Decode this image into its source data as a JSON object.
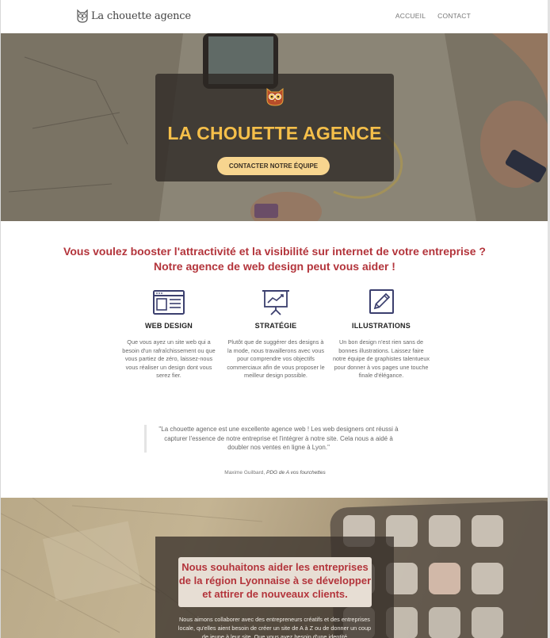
{
  "header": {
    "logo_text": "La chouette agence",
    "nav": [
      "ACCUEIL",
      "CONTACT"
    ]
  },
  "hero": {
    "title": "LA CHOUETTE AGENCE",
    "cta_label": "CONTACTER NOTRE ÉQUIPE"
  },
  "intro": {
    "line1": "Vous voulez booster l'attractivité et la visibilité sur internet de votre entreprise ?",
    "line2": "Notre agence de web design peut vous aider !"
  },
  "services": [
    {
      "icon": "browser-window-icon",
      "title": "WEB DESIGN",
      "text": "Que vous ayez un site web qui a besoin d'un rafraîchissement ou que vous partiez de zéro, laissez-nous vous réaliser un design dont vous serez fier."
    },
    {
      "icon": "presentation-chart-icon",
      "title": "STRATÉGIE",
      "text": "Plutôt que de suggérer des designs à la mode, nous travaillerons avec vous pour comprendre vos objectifs commerciaux afin de vous proposer le meilleur design possible."
    },
    {
      "icon": "pencil-icon",
      "title": "ILLUSTRATIONS",
      "text": "Un bon design n'est rien sans de bonnes illustrations. Laissez faire notre équipe de graphistes talentueux pour donner à vos pages une touche finale d'élégance."
    }
  ],
  "testimonial": {
    "quote": "\"La chouette agence est une excellente agence web ! Les web designers ont réussi à capturer l'essence de notre entreprise et l'intégrer à notre site. Cela nous a aidé à doubler nos ventes en ligne à Lyon.\"",
    "author": "Maxime Guilbard,",
    "role": "PDG de A vos fourchettes"
  },
  "bottom": {
    "title": "Nous souhaitons aider les entreprises de la région Lyonnaise à se développer et attirer de nouveaux clients.",
    "text": "Nous aimons collaborer avec des entrepreneurs créatifs et des entreprises locale, qu'elles aient besoin de créer un site de A à Z ou de donner un coup de jeune à leur site. Que vous ayez besoin d'une identité"
  },
  "colors": {
    "accent_red": "#b3343b",
    "hero_title": "#f5bf4a",
    "cta_bg": "#f7d58f",
    "icon_navy": "#3b3f6e"
  }
}
